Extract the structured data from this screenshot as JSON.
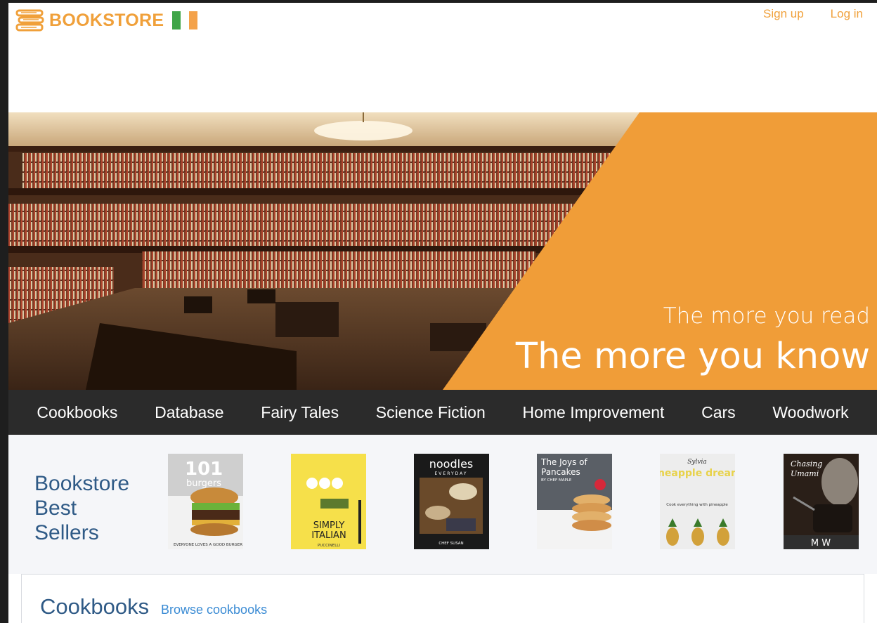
{
  "header": {
    "logo_text": "BOOKSTORE",
    "signup_label": "Sign up",
    "login_label": "Log in"
  },
  "hero": {
    "line1": "The more you read",
    "line2": "The more you know"
  },
  "nav": {
    "items": [
      "Cookbooks",
      "Database",
      "Fairy Tales",
      "Science Fiction",
      "Home Improvement",
      "Cars",
      "Woodwork"
    ]
  },
  "bestsellers": {
    "title_line1": "Bookstore",
    "title_line2": "Best",
    "title_line3": "Sellers",
    "books": [
      {
        "title": "101",
        "subtitle": "burgers",
        "footer": "EVERYONE LOVES A GOOD BURGER"
      },
      {
        "title": "SIMPLY",
        "subtitle": "ITALIAN",
        "footer": "PUCCINELLI"
      },
      {
        "title": "noodles",
        "subtitle": "EVERYDAY",
        "footer": "CHEF SUSAN"
      },
      {
        "title": "The Joys of",
        "subtitle": "Pancakes",
        "footer": "BY CHEF MAPLE"
      },
      {
        "title": "Sylvia",
        "subtitle": "pineapple dreams",
        "footer": "Cook everything with pineapple"
      },
      {
        "title": "Chasing",
        "subtitle": "Umami",
        "footer": "M W"
      }
    ]
  },
  "cookbooks": {
    "title": "Cookbooks",
    "browse_label": "Browse cookbooks"
  },
  "colors": {
    "accent": "#f0a03a",
    "nav_bg": "#2b2b2b",
    "heading_blue": "#2f5a86",
    "link_blue": "#3a8bd4"
  }
}
